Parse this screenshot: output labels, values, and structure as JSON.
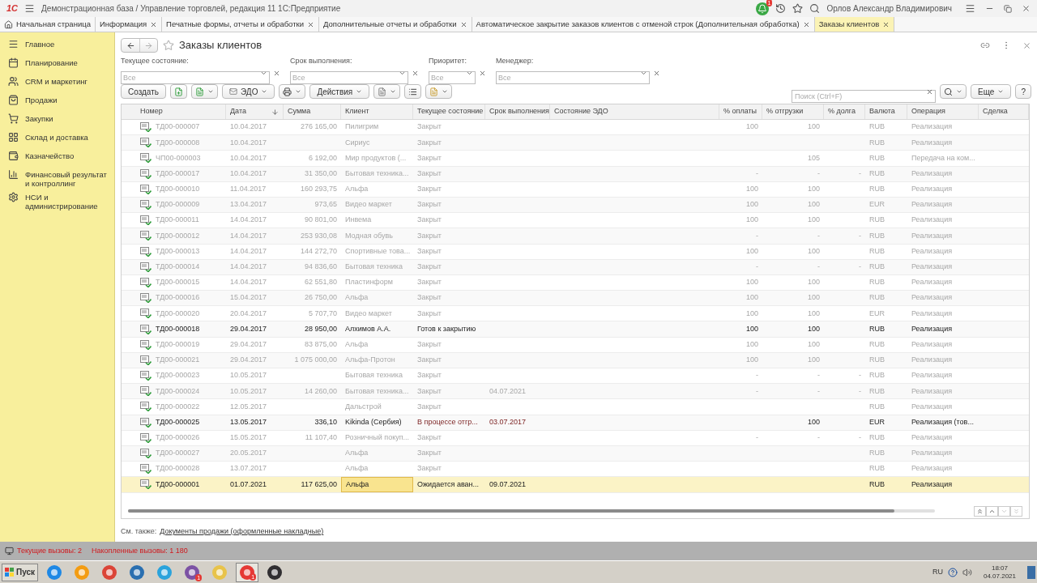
{
  "app": {
    "logo": "1С",
    "title": "Демонстрационная база / Управление торговлей, редакция 11 1С:Предприятие",
    "notifications": "1",
    "user": "Орлов Александр Владимирович"
  },
  "tabs": [
    {
      "label": "Начальная страница",
      "kind": "home",
      "selected": false
    },
    {
      "label": "Информация",
      "kind": "tab",
      "selected": false
    },
    {
      "label": "Печатные формы, отчеты и обработки",
      "kind": "tab",
      "selected": false
    },
    {
      "label": "Дополнительные отчеты и обработки",
      "kind": "tab",
      "selected": false
    },
    {
      "label": "Автоматическое закрытие заказов клиентов с отменой строк (Дополнительная обработка)",
      "kind": "tab",
      "selected": false
    },
    {
      "label": "Заказы клиентов",
      "kind": "tab",
      "selected": true
    }
  ],
  "sidebar": {
    "items": [
      {
        "label": "Главное",
        "kind": "main"
      },
      {
        "label": "Планирование",
        "kind": "plan"
      },
      {
        "label": "CRM и маркетинг",
        "kind": "crm"
      },
      {
        "label": "Продажи",
        "kind": "sales"
      },
      {
        "label": "Закупки",
        "kind": "purchases"
      },
      {
        "label": "Склад и доставка",
        "kind": "stock"
      },
      {
        "label": "Казначейство",
        "kind": "treasury"
      },
      {
        "label": "Финансовый результат и контроллинг",
        "kind": "finance"
      },
      {
        "label": "НСИ и администрирование",
        "kind": "admin"
      }
    ]
  },
  "page": {
    "title": "Заказы клиентов"
  },
  "filters": [
    {
      "label": "Текущее состояние:",
      "placeholder": "Все"
    },
    {
      "label": "Срок выполнения:",
      "placeholder": "Все"
    },
    {
      "label": "Приоритет:",
      "placeholder": "Все"
    },
    {
      "label": "Менеджер:",
      "placeholder": "Все"
    }
  ],
  "toolbar": {
    "create": "Создать",
    "edo": "ЭДО",
    "actions": "Действия",
    "search_placeholder": "Поиск (Ctrl+F)",
    "more": "Еще",
    "help": "?"
  },
  "table": {
    "columns": [
      "Номер",
      "Дата",
      "Сумма",
      "Клиент",
      "Текущее состояние",
      "Срок выполнения",
      "Состояние ЭДО",
      "% оплаты",
      "% отгрузки",
      "% долга",
      "Валюта",
      "Операция",
      "Сделка"
    ],
    "rows": [
      {
        "kind": "closed",
        "selected": false,
        "number": "ТД00-000007",
        "date": "10.04.2017",
        "sum": "276 165,00",
        "client": "Пилигрим",
        "state": "Закрыт",
        "paid": "100",
        "shipped": "100",
        "currency": "RUB",
        "operation": "Реализация"
      },
      {
        "kind": "closed",
        "selected": false,
        "number": "ТД00-000008",
        "date": "10.04.2017",
        "client": "Сириус",
        "state": "Закрыт",
        "currency": "RUB",
        "operation": "Реализация"
      },
      {
        "kind": "closed",
        "selected": false,
        "number": "ЧП00-000003",
        "date": "10.04.2017",
        "sum": "6 192,00",
        "client": "Мир продуктов (...",
        "state": "Закрыт",
        "shipped": "105",
        "currency": "RUB",
        "operation": "Передача на ком..."
      },
      {
        "kind": "closed",
        "selected": false,
        "number": "ТД00-000017",
        "date": "10.04.2017",
        "sum": "31 350,00",
        "client": "Бытовая техника...",
        "state": "Закрыт",
        "paid": "-",
        "shipped": "-",
        "debt": "-",
        "currency": "RUB",
        "operation": "Реализация"
      },
      {
        "kind": "closed",
        "selected": false,
        "number": "ТД00-000010",
        "date": "11.04.2017",
        "sum": "160 293,75",
        "client": "Альфа",
        "state": "Закрыт",
        "paid": "100",
        "shipped": "100",
        "currency": "RUB",
        "operation": "Реализация"
      },
      {
        "kind": "closed",
        "selected": false,
        "number": "ТД00-000009",
        "date": "13.04.2017",
        "sum": "973,65",
        "client": "Видео маркет",
        "state": "Закрыт",
        "paid": "100",
        "shipped": "100",
        "currency": "EUR",
        "operation": "Реализация"
      },
      {
        "kind": "closed",
        "selected": false,
        "number": "ТД00-000011",
        "date": "14.04.2017",
        "sum": "90 801,00",
        "client": "Инвема",
        "state": "Закрыт",
        "paid": "100",
        "shipped": "100",
        "currency": "RUB",
        "operation": "Реализация"
      },
      {
        "kind": "closed",
        "selected": false,
        "number": "ТД00-000012",
        "date": "14.04.2017",
        "sum": "253 930,08",
        "client": "Модная обувь",
        "state": "Закрыт",
        "paid": "-",
        "shipped": "-",
        "debt": "-",
        "currency": "RUB",
        "operation": "Реализация"
      },
      {
        "kind": "closed",
        "selected": false,
        "number": "ТД00-000013",
        "date": "14.04.2017",
        "sum": "144 272,70",
        "client": "Спортивные това...",
        "state": "Закрыт",
        "paid": "100",
        "shipped": "100",
        "currency": "RUB",
        "operation": "Реализация"
      },
      {
        "kind": "closed",
        "selected": false,
        "number": "ТД00-000014",
        "date": "14.04.2017",
        "sum": "94 836,60",
        "client": "Бытовая техника",
        "state": "Закрыт",
        "paid": "-",
        "shipped": "-",
        "debt": "-",
        "currency": "RUB",
        "operation": "Реализация"
      },
      {
        "kind": "closed",
        "selected": false,
        "number": "ТД00-000015",
        "date": "14.04.2017",
        "sum": "62 551,80",
        "client": "Пластинформ",
        "state": "Закрыт",
        "paid": "100",
        "shipped": "100",
        "currency": "RUB",
        "operation": "Реализация"
      },
      {
        "kind": "closed",
        "selected": false,
        "number": "ТД00-000016",
        "date": "15.04.2017",
        "sum": "26 750,00",
        "client": "Альфа",
        "state": "Закрыт",
        "paid": "100",
        "shipped": "100",
        "currency": "RUB",
        "operation": "Реализация"
      },
      {
        "kind": "closed",
        "selected": false,
        "number": "ТД00-000020",
        "date": "20.04.2017",
        "sum": "5 707,70",
        "client": "Видео маркет",
        "state": "Закрыт",
        "paid": "100",
        "shipped": "100",
        "currency": "EUR",
        "operation": "Реализация"
      },
      {
        "kind": "open",
        "selected": false,
        "number": "ТД00-000018",
        "date": "29.04.2017",
        "sum": "28 950,00",
        "client": "Алхимов А.А.",
        "state": "Готов к закрытию",
        "paid": "100",
        "shipped": "100",
        "currency": "RUB",
        "operation": "Реализация"
      },
      {
        "kind": "closed",
        "selected": false,
        "number": "ТД00-000019",
        "date": "29.04.2017",
        "sum": "83 875,00",
        "client": "Альфа",
        "state": "Закрыт",
        "paid": "100",
        "shipped": "100",
        "currency": "RUB",
        "operation": "Реализация"
      },
      {
        "kind": "closed",
        "selected": false,
        "number": "ТД00-000021",
        "date": "29.04.2017",
        "sum": "1 075 000,00",
        "client": "Альфа-Протон",
        "state": "Закрыт",
        "paid": "100",
        "shipped": "100",
        "currency": "RUB",
        "operation": "Реализация"
      },
      {
        "kind": "closed",
        "selected": false,
        "number": "ТД00-000023",
        "date": "10.05.2017",
        "client": "Бытовая техника",
        "state": "Закрыт",
        "paid": "-",
        "shipped": "-",
        "debt": "-",
        "currency": "RUB",
        "operation": "Реализация"
      },
      {
        "kind": "closed",
        "selected": false,
        "number": "ТД00-000024",
        "date": "10.05.2017",
        "sum": "14 260,00",
        "client": "Бытовая техника...",
        "state": "Закрыт",
        "due": "04.07.2021",
        "paid": "-",
        "shipped": "-",
        "debt": "-",
        "currency": "RUB",
        "operation": "Реализация"
      },
      {
        "kind": "closed",
        "selected": false,
        "number": "ТД00-000022",
        "date": "12.05.2017",
        "client": "Дальстрой",
        "state": "Закрыт",
        "currency": "RUB",
        "operation": "Реализация"
      },
      {
        "kind": "overdue",
        "selected": false,
        "number": "ТД00-000025",
        "date": "13.05.2017",
        "sum": "336,10",
        "client": "Kikinda (Сербия)",
        "state": "В процессе отгр...",
        "due": "03.07.2017",
        "shipped": "100",
        "currency": "EUR",
        "operation": "Реализация (тов..."
      },
      {
        "kind": "closed",
        "selected": false,
        "number": "ТД00-000026",
        "date": "15.05.2017",
        "sum": "11 107,40",
        "client": "Розничный покуп...",
        "state": "Закрыт",
        "paid": "-",
        "shipped": "-",
        "debt": "-",
        "currency": "RUB",
        "operation": "Реализация"
      },
      {
        "kind": "closed",
        "selected": false,
        "number": "ТД00-000027",
        "date": "20.05.2017",
        "client": "Альфа",
        "state": "Закрыт",
        "currency": "RUB",
        "operation": "Реализация"
      },
      {
        "kind": "closed",
        "selected": false,
        "number": "ТД00-000028",
        "date": "13.07.2017",
        "client": "Альфа",
        "state": "Закрыт",
        "currency": "RUB",
        "operation": "Реализация"
      },
      {
        "kind": "open",
        "selected": true,
        "number": "ТД00-000001",
        "date": "01.07.2021",
        "sum": "117 625,00",
        "client": "Альфа",
        "state": "Ожидается аван...",
        "due": "09.07.2021",
        "currency": "RUB",
        "operation": "Реализация"
      }
    ]
  },
  "see_also": {
    "label": "См. также:",
    "link": "Документы продажи (оформленные накладные)"
  },
  "status_bar": {
    "current_calls": "Текущие вызовы: 2",
    "total_calls": "Накопленные вызовы: 1 180"
  },
  "taskbar": {
    "start": "Пуск",
    "apps": [
      {
        "kind": "ie"
      },
      {
        "kind": "media"
      },
      {
        "kind": "chrome"
      },
      {
        "kind": "thunderbird"
      },
      {
        "kind": "telegram"
      },
      {
        "kind": "viber",
        "badge": "1"
      },
      {
        "kind": "folder"
      },
      {
        "kind": "onec",
        "badge": "1"
      },
      {
        "kind": "obs"
      }
    ],
    "language": "RU",
    "time": "18:07",
    "date": "04.07.2021"
  }
}
